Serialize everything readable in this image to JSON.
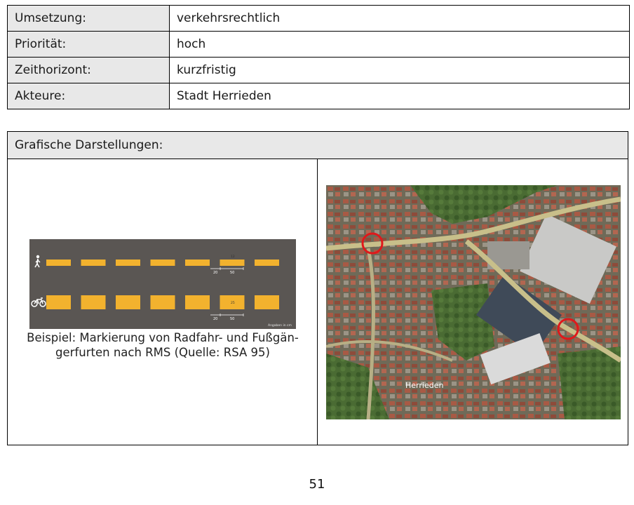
{
  "meta_rows": [
    {
      "key": "Umsetzung:",
      "value": "verkehrsrechtlich"
    },
    {
      "key": "Priorität:",
      "value": "hoch"
    },
    {
      "key": "Zeithorizont:",
      "value": "kurzfristig"
    },
    {
      "key": "Akteure:",
      "value": "Stadt Herrieden"
    }
  ],
  "graphics": {
    "title": "Grafische Darstellungen:",
    "marking": {
      "dim_width": "50",
      "dim_gap": "20",
      "ped_height": "12",
      "bike_height": "25",
      "unit_note": "Angaben in cm",
      "marking_color": "#f2b22e",
      "road_color": "#5a5653"
    },
    "caption_line1": "Beispiel: Markierung von Radfahr- und Fußgän-",
    "caption_line2": "gerfurten nach RMS (Quelle: RSA 95)",
    "map": {
      "place_label": "Herrieden",
      "highlight_color": "#e0181b"
    }
  },
  "page_number": "51"
}
